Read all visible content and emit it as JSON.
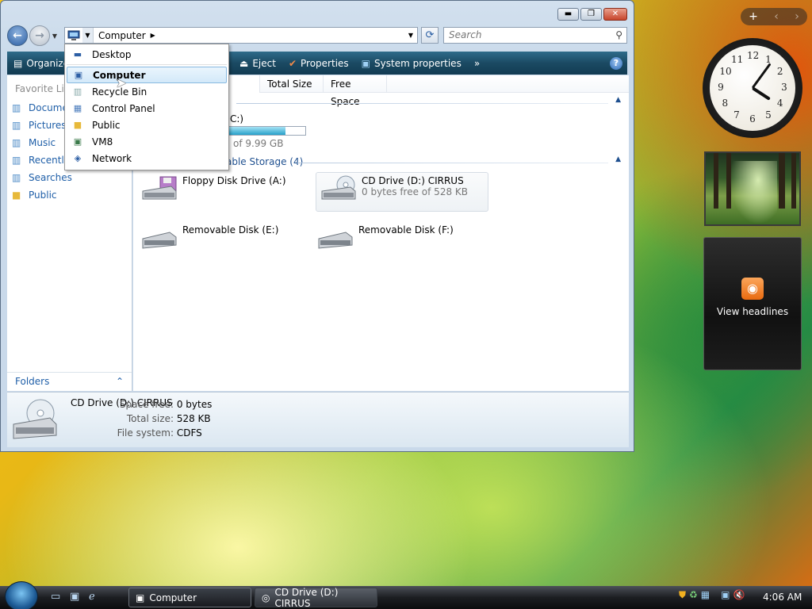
{
  "window": {
    "title_buttons": {
      "minimize": "▬",
      "maximize": "❐",
      "close": "✕"
    },
    "nav": {
      "back": "←",
      "forward": "→"
    },
    "address": {
      "breadcrumb": "Computer"
    },
    "search": {
      "placeholder": "Search"
    },
    "toolbar": {
      "items": [
        {
          "label": "Organize",
          "icon": "organize-icon"
        },
        {
          "label": "Eject",
          "icon": "eject-icon"
        },
        {
          "label": "Properties",
          "icon": "properties-icon"
        },
        {
          "label": "System properties",
          "icon": "system-properties-icon"
        }
      ],
      "more": "»",
      "help": "?"
    },
    "favorites": {
      "header": "Favorite Links",
      "items": [
        {
          "label": "Documents",
          "icon": "documents-icon"
        },
        {
          "label": "Pictures",
          "icon": "pictures-icon"
        },
        {
          "label": "Music",
          "icon": "music-icon"
        },
        {
          "label": "Recently Changed",
          "icon": "recently-changed-icon"
        },
        {
          "label": "Searches",
          "icon": "searches-icon"
        },
        {
          "label": "Public",
          "icon": "public-folder-icon"
        }
      ],
      "folders_label": "Folders"
    },
    "columns": [
      "Total Size",
      "Free Space"
    ],
    "hard_disk": {
      "label_partial": "C:)",
      "free_partial": "of 9.99 GB",
      "used_fraction": 0.8
    },
    "group_removable": {
      "label": "able Storage (4)"
    },
    "devices": [
      {
        "name": "Floppy Disk Drive (A:)",
        "sub": ""
      },
      {
        "name": "CD Drive (D:) CIRRUS",
        "sub": "0 bytes free of 528 KB"
      },
      {
        "name": "Removable Disk (E:)",
        "sub": ""
      },
      {
        "name": "Removable Disk (F:)",
        "sub": ""
      }
    ],
    "details": {
      "name": "CD Drive (D:) CIRRUS",
      "rows": [
        {
          "label": "Space free:",
          "value": "0 bytes"
        },
        {
          "label": "Total size:",
          "value": "528 KB"
        },
        {
          "label": "File system:",
          "value": "CDFS"
        }
      ]
    }
  },
  "address_menu": {
    "items": [
      {
        "label": "Desktop",
        "icon": "desktop-icon"
      },
      {
        "label": "Computer",
        "icon": "computer-icon",
        "highlighted": true
      },
      {
        "label": "Recycle Bin",
        "icon": "recycle-bin-icon"
      },
      {
        "label": "Control Panel",
        "icon": "control-panel-icon"
      },
      {
        "label": "Public",
        "icon": "public-folder-icon"
      },
      {
        "label": "VM8",
        "icon": "vm8-icon"
      },
      {
        "label": "Network",
        "icon": "network-icon"
      }
    ]
  },
  "gadgets": {
    "clock": {
      "numerals": [
        "12",
        "1",
        "2",
        "3",
        "4",
        "5",
        "6",
        "7",
        "8",
        "9",
        "10",
        "11"
      ],
      "time": "4:06"
    },
    "feed": {
      "label": "View headlines"
    }
  },
  "taskbar": {
    "tasks": [
      {
        "label": "Computer",
        "active": true
      },
      {
        "label": "CD Drive (D:) CIRRUS",
        "active": false
      }
    ],
    "clock": "4:06 AM"
  }
}
